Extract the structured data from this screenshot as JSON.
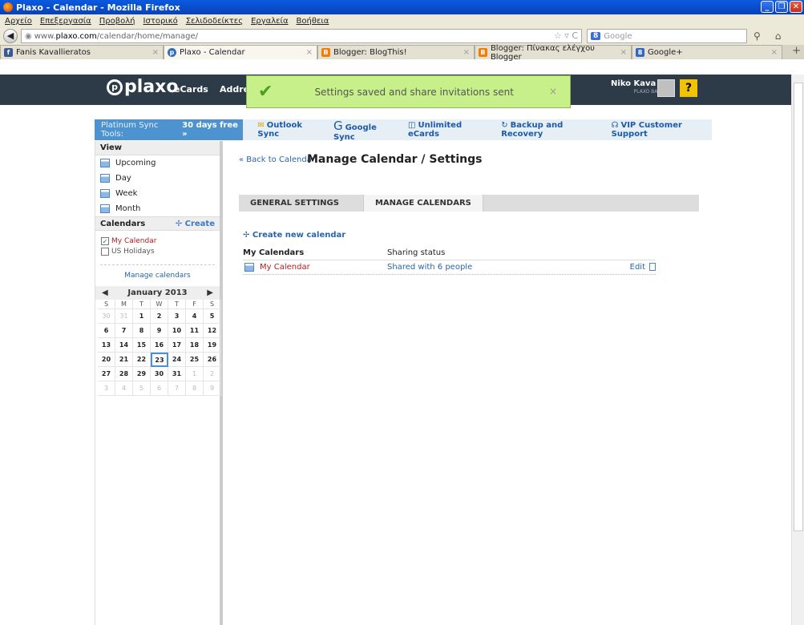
{
  "window": {
    "title": "Plaxo - Calendar - Mozilla Firefox"
  },
  "menu": [
    "Αρχείο",
    "Επεξεργασία",
    "Προβολή",
    "Ιστορικό",
    "Σελιδοδείκτες",
    "Εργαλεία",
    "Βοήθεια"
  ],
  "url": {
    "prefix": "www.",
    "domain": "plaxo.com",
    "path": "/calendar/home/manage/"
  },
  "search": {
    "placeholder": "Google"
  },
  "tabs": [
    {
      "label": "Fanis Kavallieratos",
      "icon": "facebook-icon",
      "color": "#3b5998"
    },
    {
      "label": "Plaxo - Calendar",
      "icon": "plaxo-icon",
      "color": "#2d6fb8"
    },
    {
      "label": "Blogger: BlogThis!",
      "icon": "blogger-icon",
      "color": "#f57d00"
    },
    {
      "label": "Blogger: Πίνακας ελέγχου Blogger",
      "icon": "blogger-icon",
      "color": "#f57d00"
    },
    {
      "label": "Google+",
      "icon": "googleplus-icon",
      "color": "#3366cc"
    }
  ],
  "header": {
    "logo": "plaxo",
    "nav": [
      "eCards",
      "Addres"
    ],
    "user": "Niko Kava",
    "plan": "PLAXO BASIC",
    "help": "?"
  },
  "toast": {
    "message": "Settings saved and share invitations sent",
    "close": "×"
  },
  "sync": {
    "platinum_prefix": "Platinum Sync Tools:",
    "platinum_offer": "30 days free »",
    "links": [
      "Outlook Sync",
      "Google Sync",
      "Unlimited eCards",
      "Backup and Recovery",
      "VIP Customer Support"
    ]
  },
  "sidebar": {
    "view_title": "View",
    "views": [
      "Upcoming",
      "Day",
      "Week",
      "Month"
    ],
    "calendars_title": "Calendars",
    "create_label": "Create",
    "calendars": [
      {
        "label": "My Calendar",
        "checked": true
      },
      {
        "label": "US Holidays",
        "checked": false
      }
    ],
    "manage_link": "Manage calendars",
    "month_label": "January 2013",
    "dow": [
      "S",
      "M",
      "T",
      "W",
      "T",
      "F",
      "S"
    ],
    "days": [
      "30",
      "31",
      "1",
      "2",
      "3",
      "4",
      "5",
      "6",
      "7",
      "8",
      "9",
      "10",
      "11",
      "12",
      "13",
      "14",
      "15",
      "16",
      "17",
      "18",
      "19",
      "20",
      "21",
      "22",
      "23",
      "24",
      "25",
      "26",
      "27",
      "28",
      "29",
      "30",
      "31",
      "1",
      "2",
      "3",
      "4",
      "5",
      "6",
      "7",
      "8",
      "9"
    ],
    "today": "23"
  },
  "main": {
    "back_link": "« Back to Calendar",
    "title": "Manage Calendar / Settings",
    "tabs": [
      "GENERAL SETTINGS",
      "MANAGE CALENDARS"
    ],
    "create_link": "Create new calendar",
    "table_headers": [
      "My Calendars",
      "Sharing status"
    ],
    "rows": [
      {
        "name": "My Calendar",
        "status": "Shared with 6 people",
        "action": "Edit"
      }
    ]
  }
}
